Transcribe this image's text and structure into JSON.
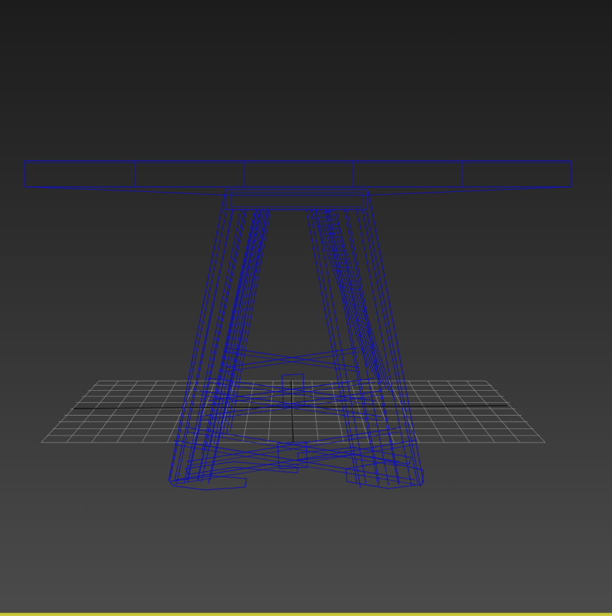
{
  "viewport": {
    "view_name": "",
    "render_mode": "wireframe",
    "background_top_color": "#1c1c1c",
    "background_bottom_color": "#4b4b4b",
    "active_border_color": "#c8c83a"
  },
  "grid": {
    "visible": true,
    "line_color": "#8a8a8a",
    "axis_color": "#111111"
  },
  "model": {
    "object": "table",
    "wire_color": "#1010b4"
  }
}
